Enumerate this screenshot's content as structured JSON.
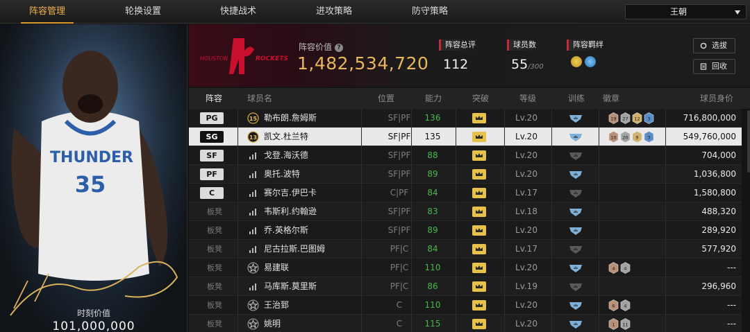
{
  "tabs": [
    {
      "label": "阵容管理",
      "active": true
    },
    {
      "label": "轮换设置",
      "active": false
    },
    {
      "label": "快捷战术",
      "active": false
    },
    {
      "label": "进攻策略",
      "active": false
    },
    {
      "label": "防守策略",
      "active": false
    }
  ],
  "user_select": {
    "value": "王朝"
  },
  "player_card": {
    "jersey_team": "THUNDER",
    "jersey_number": "35",
    "moment_label": "时刻价值",
    "moment_value": "101,000,000"
  },
  "summary": {
    "team_logo_text": "ROCKETS",
    "team_logo_city": "HOUSTON",
    "value_label": "阵容价值",
    "value": "1,482,534,720",
    "rating_label": "阵容总评",
    "rating": "112",
    "players_label": "球员数",
    "players": "55",
    "players_max": "/300",
    "bond_label": "阵容羁绊",
    "select_button": "选拔",
    "recycle_button": "回收"
  },
  "table": {
    "headers": [
      "阵容",
      "球员名",
      "位置",
      "能力",
      "突破",
      "等级",
      "训练",
      "徽章",
      "球员身价"
    ],
    "rows": [
      {
        "slot": "PG",
        "starter": true,
        "badge": "15",
        "name": "勒布朗.詹姆斯",
        "pos": "SF|PF",
        "ability": "136",
        "level": "Lv.20",
        "train": "blue",
        "medals": [
          "19",
          "27",
          "12",
          "3"
        ],
        "price": "716,800,000",
        "selected": false
      },
      {
        "slot": "SG",
        "starter": true,
        "badge": "13",
        "name": "凯文.杜兰特",
        "pos": "SF|PF",
        "ability": "135",
        "level": "Lv.20",
        "train": "blue",
        "medals": [
          "10",
          "20",
          "9",
          "3"
        ],
        "price": "549,760,000",
        "selected": true
      },
      {
        "slot": "SF",
        "starter": true,
        "badge": "",
        "name": "戈登.海沃德",
        "pos": "SF|PF",
        "ability": "88",
        "level": "Lv.20",
        "train": "gray",
        "medals": [],
        "price": "704,000",
        "selected": false
      },
      {
        "slot": "PF",
        "starter": true,
        "badge": "",
        "name": "奥托.波特",
        "pos": "SF|PF",
        "ability": "89",
        "level": "Lv.20",
        "train": "blue",
        "medals": [],
        "price": "1,036,800",
        "selected": false
      },
      {
        "slot": "C",
        "starter": true,
        "badge": "",
        "name": "赛尔吉.伊巴卡",
        "pos": "C|PF",
        "ability": "84",
        "level": "Lv.17",
        "train": "gray",
        "medals": [],
        "price": "1,580,800",
        "selected": false
      },
      {
        "slot": "板凳",
        "starter": false,
        "badge": "",
        "name": "韦斯利.约翰逊",
        "pos": "SF|PF",
        "ability": "83",
        "level": "Lv.18",
        "train": "blue",
        "medals": [],
        "price": "488,320",
        "selected": false
      },
      {
        "slot": "板凳",
        "starter": false,
        "badge": "",
        "name": "乔.英格尔斯",
        "pos": "SF|PF",
        "ability": "89",
        "level": "Lv.20",
        "train": "blue",
        "medals": [],
        "price": "289,920",
        "selected": false
      },
      {
        "slot": "板凳",
        "starter": false,
        "badge": "",
        "name": "尼古拉斯.巴图姆",
        "pos": "PF|C",
        "ability": "84",
        "level": "Lv.17",
        "train": "gray",
        "medals": [],
        "price": "577,920",
        "selected": false
      },
      {
        "slot": "板凳",
        "starter": false,
        "badge": "star",
        "name": "易建联",
        "pos": "PF|C",
        "ability": "110",
        "level": "Lv.20",
        "train": "blue",
        "medals": [
          "4",
          "4"
        ],
        "price": "---",
        "selected": false
      },
      {
        "slot": "板凳",
        "starter": false,
        "badge": "",
        "name": "马库斯.莫里斯",
        "pos": "PF|C",
        "ability": "86",
        "level": "Lv.19",
        "train": "gray",
        "medals": [],
        "price": "296,960",
        "selected": false
      },
      {
        "slot": "板凳",
        "starter": false,
        "badge": "star",
        "name": "王治郅",
        "pos": "C",
        "ability": "110",
        "level": "Lv.20",
        "train": "blue",
        "medals": [
          "6",
          "4"
        ],
        "price": "---",
        "selected": false
      },
      {
        "slot": "板凳",
        "starter": false,
        "badge": "star",
        "name": "姚明",
        "pos": "C",
        "ability": "115",
        "level": "Lv.20",
        "train": "blue",
        "medals": [
          "1",
          "11"
        ],
        "price": "---",
        "selected": false
      }
    ]
  },
  "colors": {
    "accent": "#e6b85a",
    "ability_green": "#47b84a",
    "tab_active": "#f0b24a"
  }
}
